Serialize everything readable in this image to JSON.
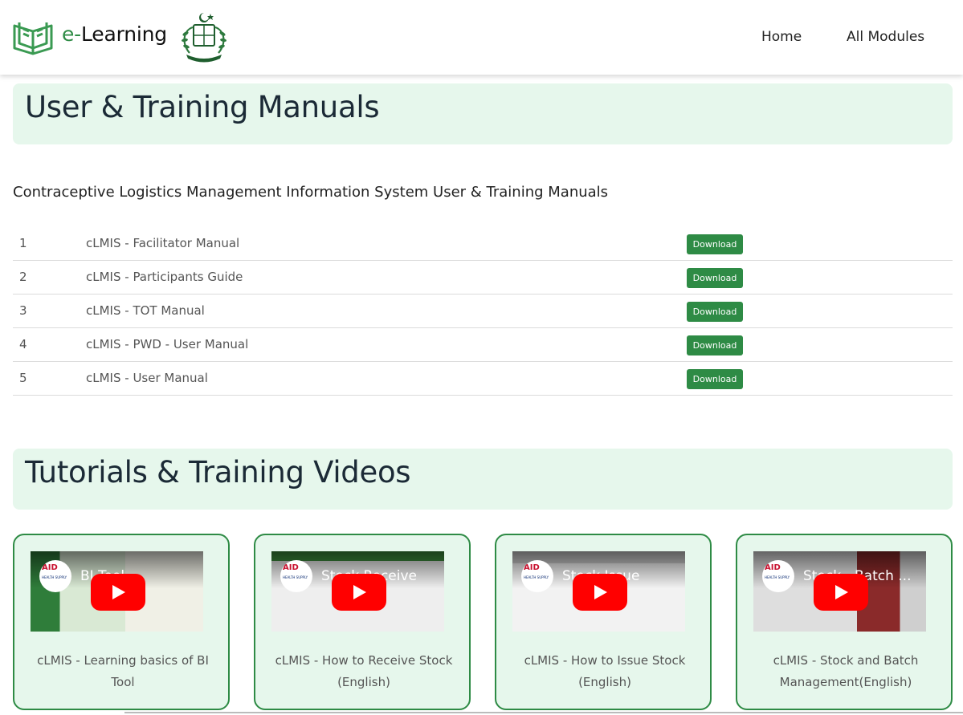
{
  "header": {
    "brand_prefix": "e-",
    "brand_suffix": "Learning",
    "nav": [
      {
        "label": "Home"
      },
      {
        "label": "All Modules"
      }
    ]
  },
  "manuals_section": {
    "title": "User & Training Manuals",
    "subtitle": "Contraceptive Logistics Management Information System User & Training Manuals",
    "rows": [
      {
        "num": "1",
        "name": "cLMIS - Facilitator Manual",
        "action": "Download"
      },
      {
        "num": "2",
        "name": "cLMIS - Participants Guide",
        "action": "Download"
      },
      {
        "num": "3",
        "name": "cLMIS - TOT Manual",
        "action": "Download"
      },
      {
        "num": "4",
        "name": "cLMIS - PWD - User Manual",
        "action": "Download"
      },
      {
        "num": "5",
        "name": "cLMIS - User Manual",
        "action": "Download"
      }
    ]
  },
  "videos_section": {
    "title": "Tutorials & Training Videos",
    "videos": [
      {
        "thumb_title": "BI Tool",
        "caption": "cLMIS - Learning basics of BI Tool",
        "channel_badge": "AID",
        "channel_sub": "HEALTH SUPPLY"
      },
      {
        "thumb_title": "Stock Receive",
        "caption": "cLMIS - How to Receive Stock (English)",
        "channel_badge": "AID",
        "channel_sub": "HEALTH SUPPLY"
      },
      {
        "thumb_title": "Stock Issue",
        "caption": "cLMIS - How to Issue Stock (English)",
        "channel_badge": "AID",
        "channel_sub": "HEALTH SUPPLY"
      },
      {
        "thumb_title": "Stock - Batch ...",
        "caption": "cLMIS - Stock and Batch Management(English)",
        "channel_badge": "AID",
        "channel_sub": "HEALTH SUPPLY"
      }
    ]
  },
  "colors": {
    "brand_green": "#2e8b45",
    "banner_bg": "#e6f7ec",
    "youtube_red": "#ff0000"
  },
  "icons": {
    "logo": "open-book-icon",
    "emblem": "state-emblem",
    "play": "youtube-play-icon"
  }
}
